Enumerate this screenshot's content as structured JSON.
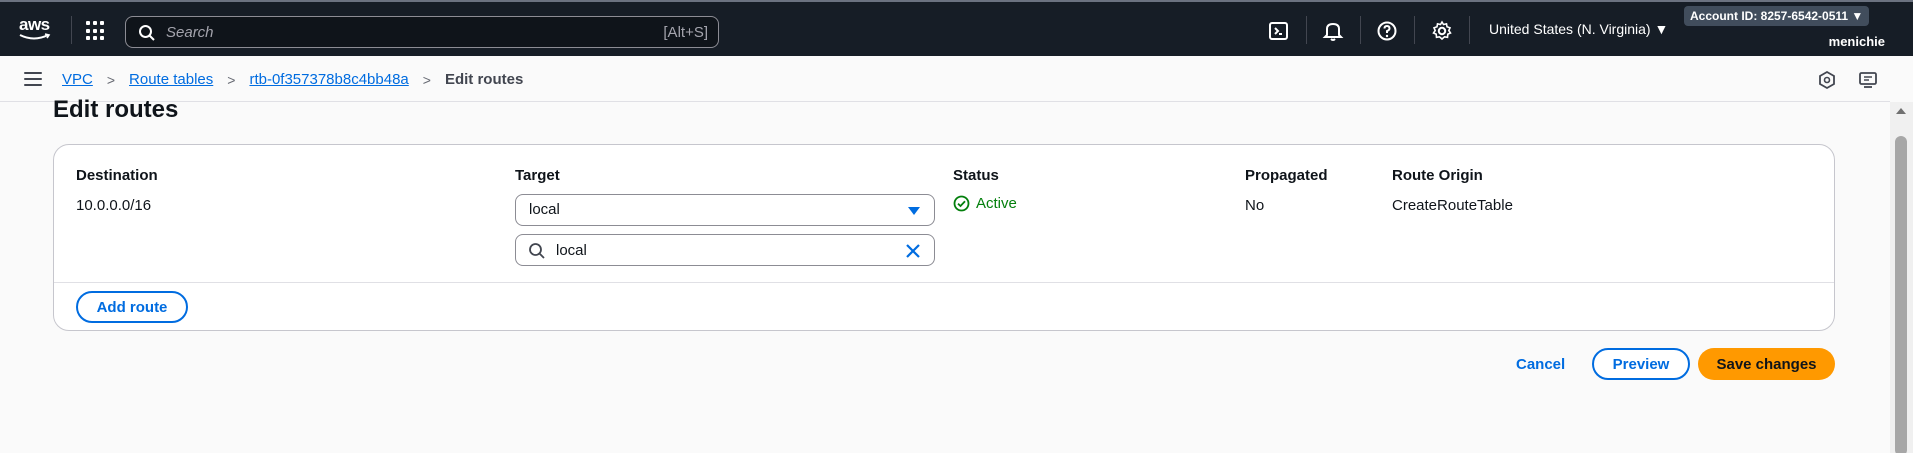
{
  "topnav": {
    "logo_text": "aws",
    "search_placeholder": "Search",
    "search_shortcut": "[Alt+S]",
    "region": "United States (N. Virginia) ▼",
    "account": "Account ID: 8257-6542-0511 ▼",
    "username": "menichie",
    "icons": [
      "cloudshell-icon",
      "bell-icon",
      "help-icon",
      "settings-icon"
    ]
  },
  "breadcrumb": {
    "items": [
      "VPC",
      "Route tables",
      "rtb-0f357378b8c4bb48a"
    ],
    "current": "Edit routes"
  },
  "page": {
    "title": "Edit routes"
  },
  "routes_table": {
    "headers": [
      "Destination",
      "Target",
      "Status",
      "Propagated",
      "Route Origin"
    ],
    "rows": [
      {
        "destination": "10.0.0.0/16",
        "target": "local",
        "target_filter": "local",
        "status": "Active",
        "propagated": "No",
        "route_origin": "CreateRouteTable"
      }
    ],
    "add_route_label": "Add route"
  },
  "actions": {
    "cancel": "Cancel",
    "preview": "Preview",
    "save": "Save changes"
  },
  "colors": {
    "nav_bg": "#161d26",
    "link": "#006ce0",
    "primary": "#ff9900",
    "success": "#037f0c"
  }
}
